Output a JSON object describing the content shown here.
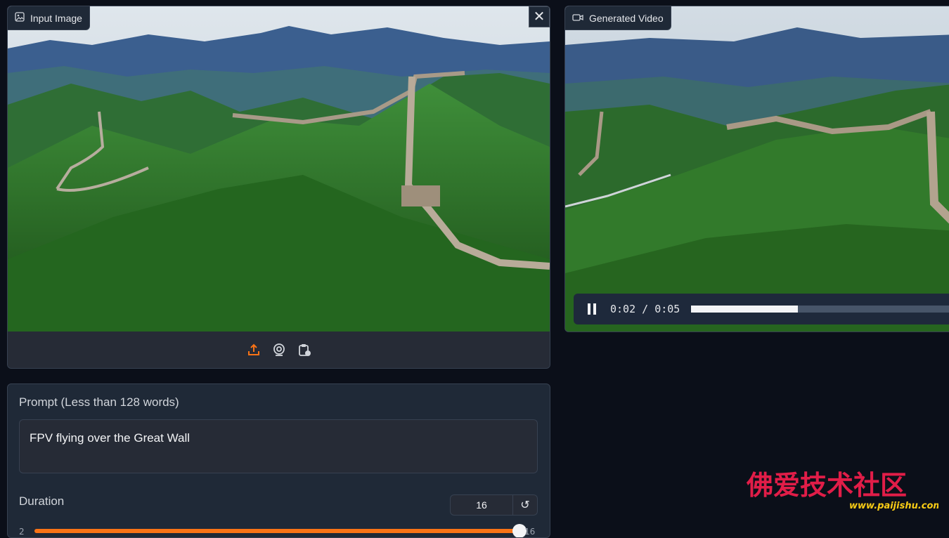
{
  "input": {
    "label": "Input Image",
    "clear_symbol": "✕",
    "sources": [
      {
        "name": "upload-icon"
      },
      {
        "name": "webcam-icon"
      },
      {
        "name": "clipboard-icon"
      }
    ]
  },
  "video": {
    "label": "Generated Video",
    "time_current": "0:02",
    "time_separator": "/",
    "time_total": "0:05",
    "progress_fraction": 0.4
  },
  "prompt": {
    "label": "Prompt (Less than 128 words)",
    "value": "FPV flying over the Great Wall"
  },
  "duration": {
    "label": "Duration",
    "value": "16",
    "min": "2",
    "max": "16",
    "reset_symbol": "↺"
  },
  "watermark": {
    "title": "佛爱技术社区",
    "url": "www.paijishu.com"
  },
  "colors": {
    "accent": "#f97316",
    "panel": "#1f2937",
    "background": "#0b0f19"
  }
}
